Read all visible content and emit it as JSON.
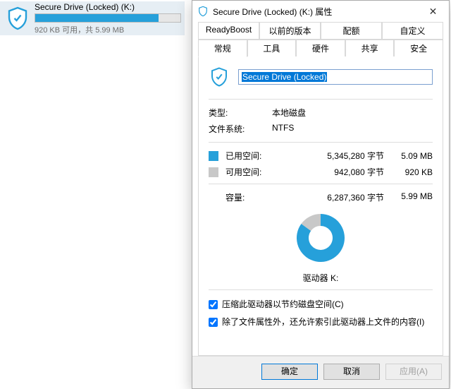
{
  "drive_item": {
    "name": "Secure Drive (Locked) (K:)",
    "sub": "920 KB 可用，共 5.99 MB",
    "fill_percent": 85
  },
  "window": {
    "title": "Secure Drive (Locked) (K:) 属性"
  },
  "tabs": {
    "row1": [
      "ReadyBoost",
      "以前的版本",
      "配额",
      "自定义"
    ],
    "row2": [
      "常规",
      "工具",
      "硬件",
      "共享",
      "安全"
    ],
    "active": "常规"
  },
  "general": {
    "volume_name": "Secure Drive (Locked)",
    "type_label": "类型:",
    "type_value": "本地磁盘",
    "fs_label": "文件系统:",
    "fs_value": "NTFS",
    "used_label": "已用空间:",
    "used_bytes": "5,345,280 字节",
    "used_human": "5.09 MB",
    "free_label": "可用空间:",
    "free_bytes": "942,080 字节",
    "free_human": "920 KB",
    "capacity_label": "容量:",
    "capacity_bytes": "6,287,360 字节",
    "capacity_human": "5.99 MB",
    "drive_label": "驱动器 K:",
    "check_compress": "压缩此驱动器以节约磁盘空间(C)",
    "check_index": "除了文件属性外，还允许索引此驱动器上文件的内容(I)"
  },
  "buttons": {
    "ok": "确定",
    "cancel": "取消",
    "apply": "应用(A)"
  },
  "colors": {
    "accent": "#26a0da",
    "free": "#c8c8c8"
  },
  "chart_data": {
    "type": "pie",
    "title": "驱动器 K:",
    "series": [
      {
        "name": "已用空间",
        "value": 5345280,
        "color": "#26a0da"
      },
      {
        "name": "可用空间",
        "value": 942080,
        "color": "#c8c8c8"
      }
    ]
  }
}
